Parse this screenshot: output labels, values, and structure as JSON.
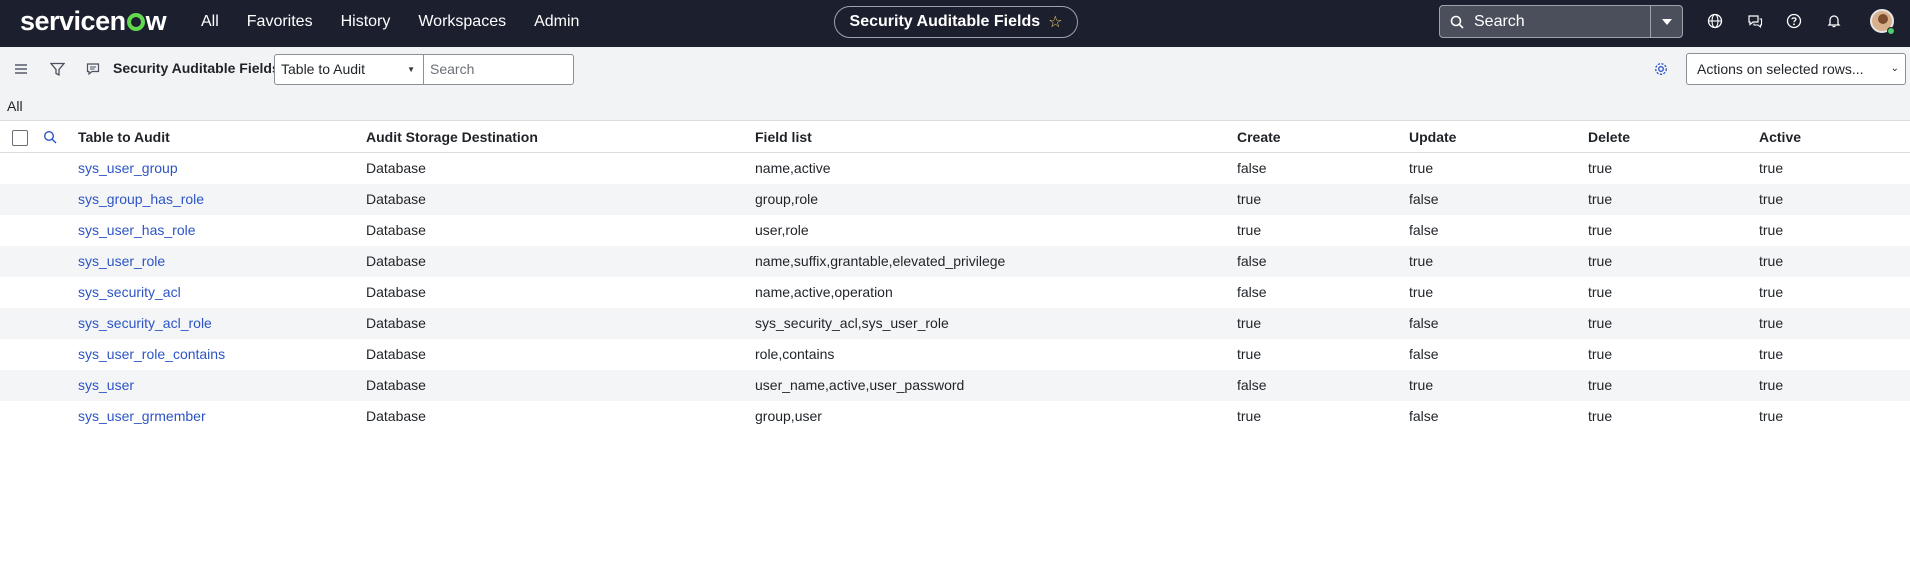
{
  "header": {
    "logo_text_left": "servicen",
    "logo_text_right": "w",
    "nav": [
      "All",
      "Favorites",
      "History",
      "Workspaces",
      "Admin"
    ],
    "page_title": "Security Auditable Fields",
    "search_placeholder": "Search"
  },
  "toolbar": {
    "list_title": "Security Auditable Fields",
    "field_select": "Table to Audit",
    "search_placeholder": "Search",
    "actions_label": "Actions on selected rows..."
  },
  "breadcrumb": "All",
  "table": {
    "columns": [
      "Table to Audit",
      "Audit Storage Destination",
      "Field list",
      "Create",
      "Update",
      "Delete",
      "Active"
    ],
    "rows": [
      [
        "sys_user_group",
        "Database",
        "name,active",
        "false",
        "true",
        "true",
        "true"
      ],
      [
        "sys_group_has_role",
        "Database",
        "group,role",
        "true",
        "false",
        "true",
        "true"
      ],
      [
        "sys_user_has_role",
        "Database",
        "user,role",
        "true",
        "false",
        "true",
        "true"
      ],
      [
        "sys_user_role",
        "Database",
        "name,suffix,grantable,elevated_privilege",
        "false",
        "true",
        "true",
        "true"
      ],
      [
        "sys_security_acl",
        "Database",
        "name,active,operation",
        "false",
        "true",
        "true",
        "true"
      ],
      [
        "sys_security_acl_role",
        "Database",
        "sys_security_acl,sys_user_role",
        "true",
        "false",
        "true",
        "true"
      ],
      [
        "sys_user_role_contains",
        "Database",
        "role,contains",
        "true",
        "false",
        "true",
        "true"
      ],
      [
        "sys_user",
        "Database",
        "user_name,active,user_password",
        "false",
        "true",
        "true",
        "true"
      ],
      [
        "sys_user_grmember",
        "Database",
        "group,user",
        "true",
        "false",
        "true",
        "true"
      ]
    ]
  },
  "colors": {
    "topbar": "#1b1f2e",
    "link": "#2c54c6",
    "logo_accent": "#62d84e"
  }
}
